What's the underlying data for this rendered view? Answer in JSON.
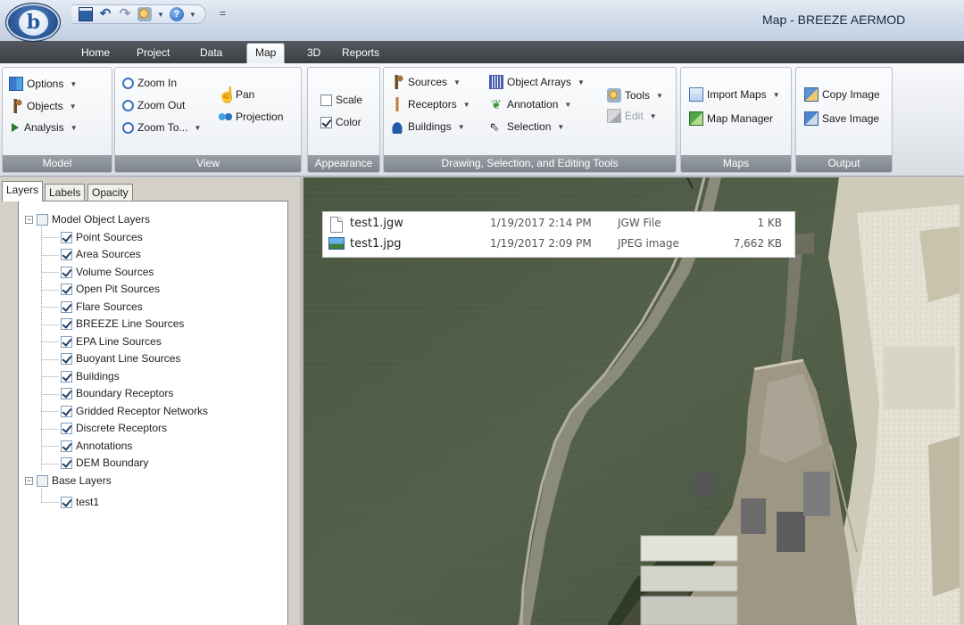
{
  "window": {
    "title": "Map - BREEZE AERMOD",
    "app_logo_letter": "b"
  },
  "quick_access": {
    "icons": [
      "save-icon",
      "undo-icon",
      "redo-icon",
      "tools-icon",
      "help-icon"
    ],
    "more": "="
  },
  "tabs": [
    {
      "label": "Home"
    },
    {
      "label": "Project"
    },
    {
      "label": "Data"
    },
    {
      "label": "Map",
      "active": true
    },
    {
      "label": "3D"
    },
    {
      "label": "Reports"
    }
  ],
  "ribbon": {
    "model": {
      "label": "Model",
      "options": "Options",
      "objects": "Objects",
      "analysis": "Analysis"
    },
    "view": {
      "label": "View",
      "zoom_in": "Zoom In",
      "zoom_out": "Zoom Out",
      "zoom_to": "Zoom To...",
      "pan": "Pan",
      "projection": "Projection"
    },
    "appearance": {
      "label": "Appearance",
      "scale": "Scale",
      "scale_checked": false,
      "color": "Color",
      "color_checked": true
    },
    "drawing": {
      "label": "Drawing, Selection, and Editing Tools",
      "sources": "Sources",
      "receptors": "Receptors",
      "buildings": "Buildings",
      "object_arrays": "Object Arrays",
      "annotation": "Annotation",
      "selection": "Selection",
      "tools": "Tools",
      "edit": "Edit"
    },
    "maps": {
      "label": "Maps",
      "import_maps": "Import Maps",
      "map_manager": "Map Manager"
    },
    "output": {
      "label": "Output",
      "copy_image": "Copy Image",
      "save_image": "Save Image"
    }
  },
  "panel": {
    "tabs": [
      "Layers",
      "Labels",
      "Opacity"
    ],
    "tree": {
      "model_layers": {
        "label": "Model Object Layers",
        "items": [
          "Point Sources",
          "Area Sources",
          "Volume Sources",
          "Open Pit Sources",
          "Flare Sources",
          "BREEZE Line Sources",
          "EPA Line Sources",
          "Buoyant Line Sources",
          "Buildings",
          "Boundary Receptors",
          "Gridded Receptor Networks",
          "Discrete Receptors",
          "Annotations",
          "DEM Boundary"
        ]
      },
      "base_layers": {
        "label": "Base Layers",
        "items": [
          "test1"
        ]
      }
    }
  },
  "files": [
    {
      "name": "test1.jgw",
      "date": "1/19/2017 2:14 PM",
      "type": "JGW File",
      "size": "1 KB",
      "icon": "document-icon"
    },
    {
      "name": "test1.jpg",
      "date": "1/19/2017 2:09 PM",
      "type": "JPEG image",
      "size": "7,662 KB",
      "icon": "image-icon"
    }
  ],
  "colors": {
    "ribbon_tab_bar": "#3a3d42",
    "group_label_bg": "#8a9098",
    "water": "#4c5a3f",
    "land": "#d9d6c8"
  }
}
